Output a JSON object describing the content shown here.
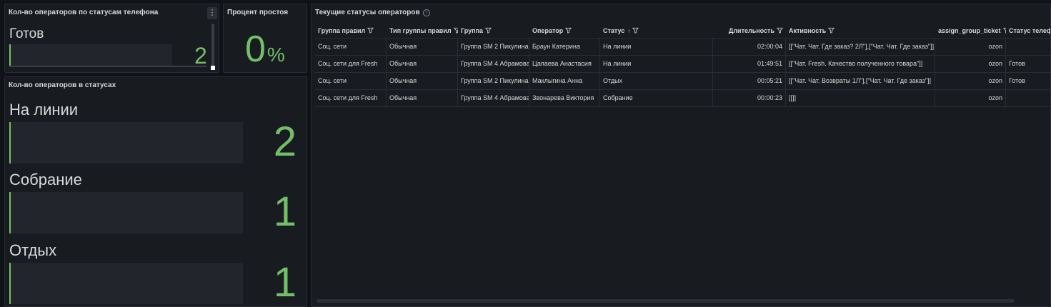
{
  "panel_phone": {
    "title": "Кол-во операторов по статусам телефона",
    "menu_glyph": "⋮",
    "items": [
      {
        "label": "Готов",
        "value": "2",
        "fraction": 0.01
      }
    ]
  },
  "panel_idle": {
    "title": "Процент простоя",
    "value": "0",
    "unit": "%"
  },
  "panel_statuses": {
    "title": "Кол-во операторов в статусах",
    "items": [
      {
        "label": "На линии",
        "value": "2",
        "fraction": 0.01
      },
      {
        "label": "Собрание",
        "value": "1",
        "fraction": 0.01
      },
      {
        "label": "Отдых",
        "value": "1",
        "fraction": 0.01
      }
    ]
  },
  "panel_table": {
    "title": "Текущие статусы операторов",
    "info_glyph": "i",
    "sort_glyph": "↑",
    "columns": [
      "Группа правил",
      "Тип группы правил",
      "Группа",
      "Оператор",
      "Статус",
      "Длительность",
      "Активность",
      "assign_group_ticket",
      "Статус телефона"
    ],
    "rows": [
      [
        "Соц. сети",
        "Обычная",
        "Группа SM 2 Пикулина",
        "Браун Катерина",
        "На линии",
        "02:00:04",
        "[[\"Чат. Чат. Где заказ? 2Л\"],[\"Чат. Чат. Где заказ\"]]",
        "ozon",
        ""
      ],
      [
        "Соц. сети для Fresh",
        "Обычная",
        "Группа SM 4 Абрамова",
        "Цапаева Анастасия",
        "На линии",
        "01:49:51",
        "[[\"Чат. Fresh. Качество полученного товара\"]]",
        "ozon",
        "Готов"
      ],
      [
        "Соц. сети",
        "Обычная",
        "Группа SM 2 Пикулина",
        "Маклыгина Анна",
        "Отдых",
        "00:05:21",
        "[[\"Чат. Чат. Возвраты 1Л\"],[\"Чат. Чат. Где заказ\"]]",
        "ozon",
        "Готов"
      ],
      [
        "Соц. сети для Fresh",
        "Обычная",
        "Группа SM 4 Абрамова",
        "Звонарева Виктория",
        "Собрание",
        "00:00:23",
        "[[]]",
        "ozon",
        ""
      ]
    ]
  },
  "colors": {
    "background": "#111217",
    "panel": "#181b1f",
    "accent_green": "#73bf69",
    "text": "#d8d9da",
    "border": "#2a2d33"
  },
  "icons": {
    "menu": "vertical-dots-icon",
    "info": "info-circle-icon",
    "filter": "filter-funnel-icon",
    "sort": "sort-ascending-icon"
  }
}
